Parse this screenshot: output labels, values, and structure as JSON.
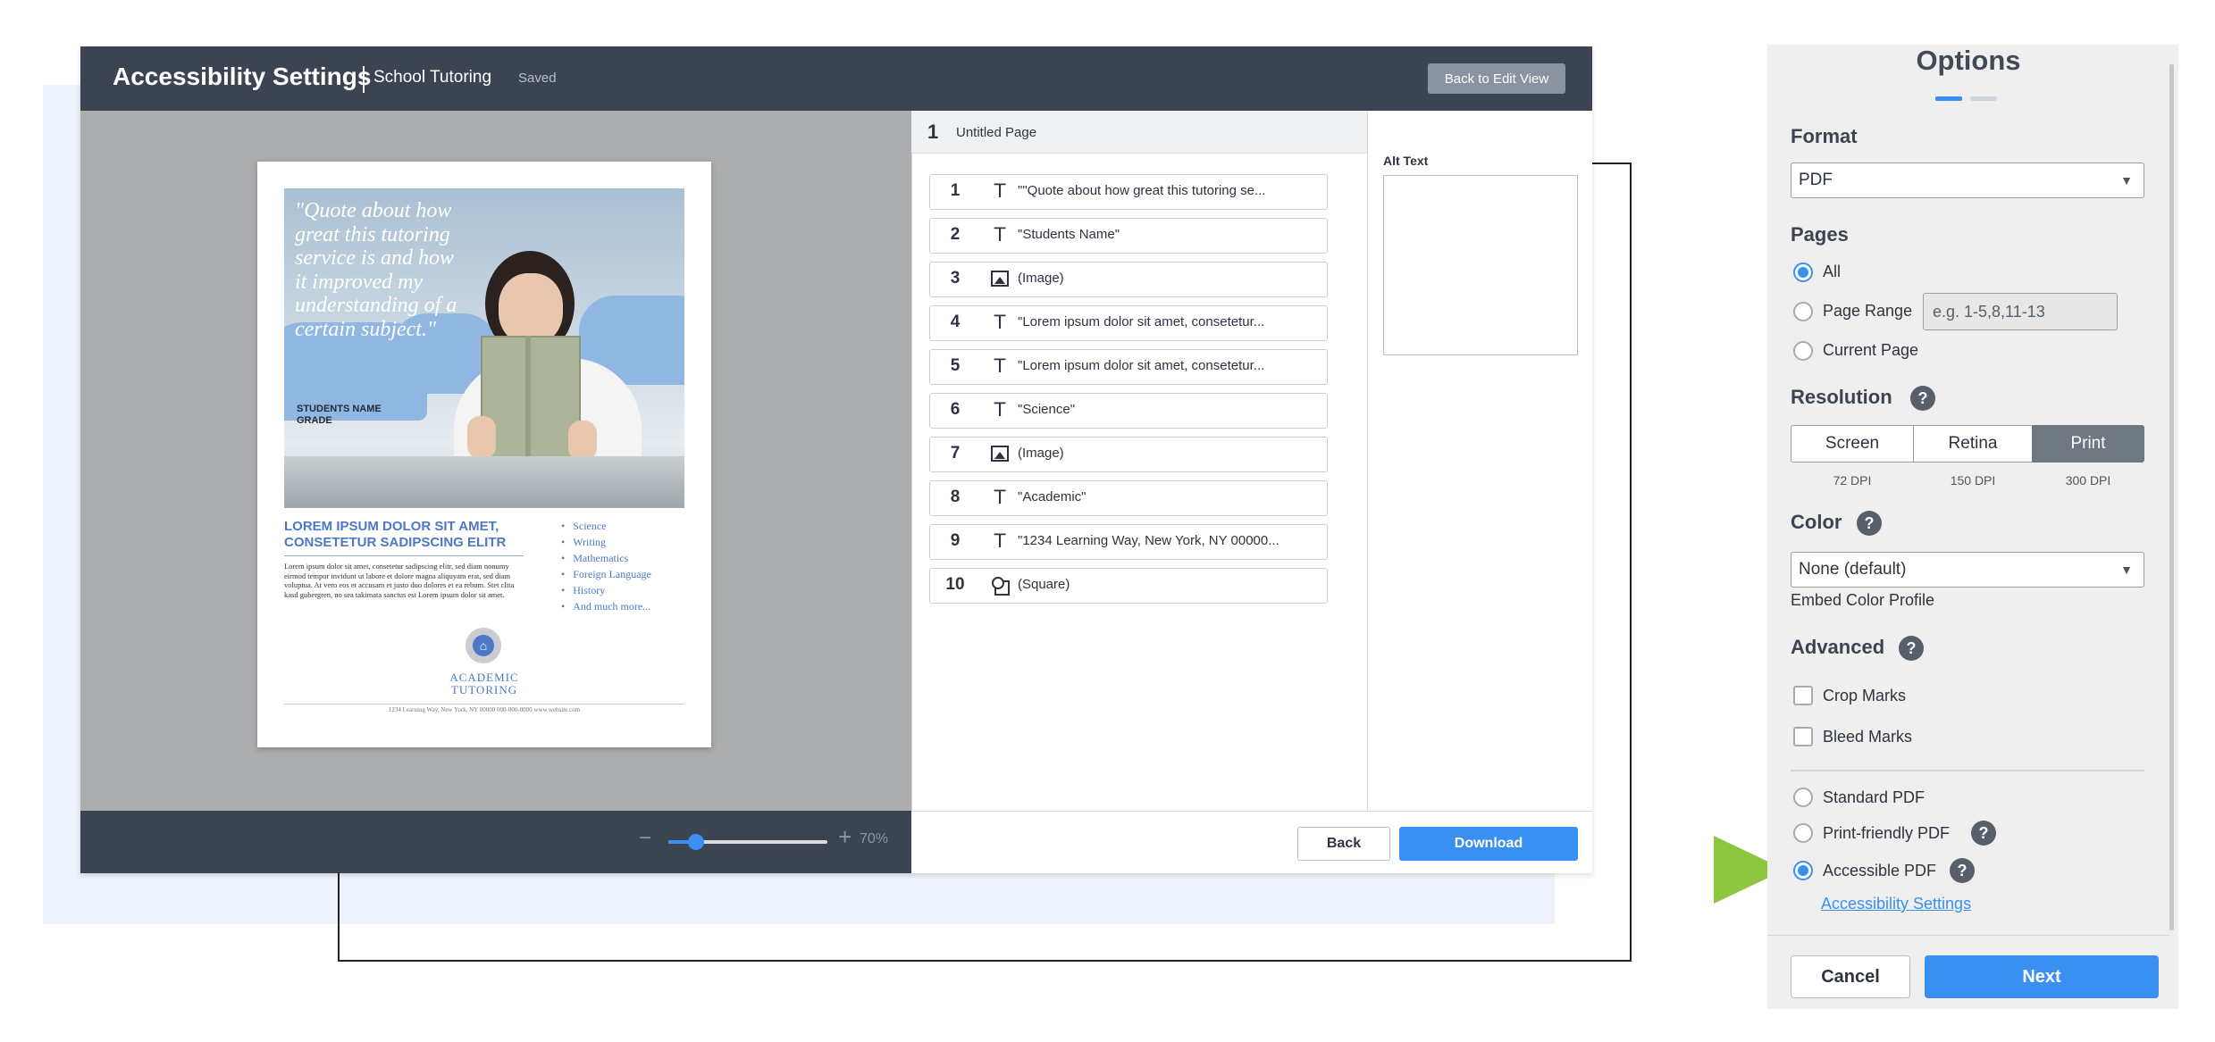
{
  "header": {
    "title": "Accessibility Settings",
    "document_name": "School Tutoring",
    "save_status": "Saved",
    "back_to_edit_label": "Back to Edit View"
  },
  "zoom": {
    "minus": "−",
    "plus": "+",
    "label": "70%",
    "level": 0.7
  },
  "poster": {
    "quote": "\"Quote about how great this tutoring service is and how it improved my understanding of a certain subject.\"",
    "student_name": "STUDENTS NAME",
    "grade": "GRADE",
    "heading": "LOREM IPSUM DOLOR SIT AMET, CONSETETUR SADIPSCING ELITR",
    "body": "Lorem ipsum dolor sit amet, consetetur sadipscing elitr, sed diam nonumy eirmod tempor invidunt ut labore et dolore magna aliquyam erat, sed diam voluptua. At vero eos et accusam et justo duo dolores et ea rebum. Stet clita kasd gubergren, no sea takimata sanctus est Lorem ipsum dolor sit amet.",
    "subjects": [
      "Science",
      "Writing",
      "Mathematics",
      "Foreign Language",
      "History",
      "And much more..."
    ],
    "logo_line1": "ACADEMIC",
    "logo_line2": "TUTORING",
    "footer": "1234 Learning Way, New York, NY 00000          000-000-0000          www.website.com"
  },
  "element_list": {
    "page_number": "1",
    "page_name": "Untitled Page",
    "items": [
      {
        "num": "1",
        "type": "text",
        "label": "\"\"Quote about how great this tutoring se..."
      },
      {
        "num": "2",
        "type": "text",
        "label": "\"Students Name\""
      },
      {
        "num": "3",
        "type": "image",
        "label": "(Image)"
      },
      {
        "num": "4",
        "type": "text",
        "label": "\"Lorem ipsum dolor sit amet, consetetur..."
      },
      {
        "num": "5",
        "type": "text",
        "label": "\"Lorem ipsum dolor sit amet, consetetur..."
      },
      {
        "num": "6",
        "type": "text",
        "label": "\"Science\""
      },
      {
        "num": "7",
        "type": "image",
        "label": "(Image)"
      },
      {
        "num": "8",
        "type": "text",
        "label": "\"Academic\""
      },
      {
        "num": "9",
        "type": "text",
        "label": "\"1234 Learning Way, New York, NY 00000..."
      },
      {
        "num": "10",
        "type": "shape",
        "label": "(Square)"
      }
    ],
    "text_glyph": "T"
  },
  "alt_text": {
    "label": "Alt Text",
    "value": ""
  },
  "footer_buttons": {
    "back_label": "Back",
    "download_label": "Download"
  },
  "options": {
    "title": "Options",
    "format": {
      "heading": "Format",
      "value": "PDF",
      "arrow": "▼"
    },
    "pages": {
      "heading": "Pages",
      "all_label": "All",
      "range_label": "Page Range",
      "range_placeholder": "e.g. 1-5,8,11-13",
      "current_label": "Current Page",
      "selected": "All"
    },
    "resolution": {
      "heading": "Resolution",
      "help": "?",
      "options": [
        {
          "label": "Screen",
          "dpi": "72 DPI"
        },
        {
          "label": "Retina",
          "dpi": "150 DPI"
        },
        {
          "label": "Print",
          "dpi": "300 DPI"
        }
      ],
      "selected": "Print"
    },
    "color": {
      "heading": "Color",
      "help": "?",
      "value": "None (default)",
      "arrow": "▼",
      "embed_label": "Embed Color Profile"
    },
    "advanced": {
      "heading": "Advanced",
      "help": "?",
      "crop_marks": "Crop Marks",
      "bleed_marks": "Bleed Marks",
      "standard_pdf": "Standard PDF",
      "print_friendly_pdf": "Print-friendly PDF",
      "accessible_pdf": "Accessible PDF",
      "selected_pdf": "Accessible PDF",
      "accessibility_link": "Accessibility Settings"
    },
    "cancel_label": "Cancel",
    "next_label": "Next"
  },
  "colors": {
    "accent": "#3a8ff3",
    "topbar": "#3b4450",
    "pointer": "#8dc63f",
    "poster_blue": "#4d78c3"
  }
}
